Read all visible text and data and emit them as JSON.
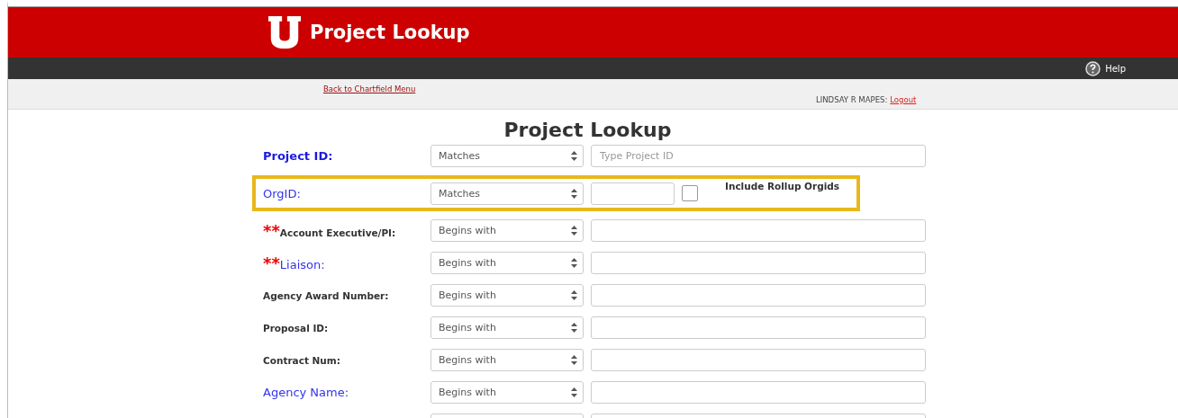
{
  "header": {
    "title": "Project Lookup"
  },
  "toolbar": {
    "help": "Help"
  },
  "subbar": {
    "back_link": "Back to Chartfield Menu",
    "user": "LINDSAY R MAPES:",
    "logout": "Logout"
  },
  "form": {
    "title": "Project Lookup",
    "rows": [
      {
        "label": "Project ID:",
        "kind": "primary",
        "operator": "Matches",
        "placeholder": "Type Project ID",
        "highlighted": false
      },
      {
        "label": "OrgID:",
        "kind": "link",
        "operator": "Matches",
        "highlighted": true,
        "checkbox": {
          "label": "Include Rollup Orgids",
          "checked": false
        }
      },
      {
        "label": "Account Executive/PI:",
        "kind": "plain",
        "required_mark": "**",
        "operator": "Begins with",
        "highlighted": false
      },
      {
        "label": "Liaison:",
        "kind": "link",
        "required_mark": "**",
        "operator": "Begins with",
        "highlighted": false
      },
      {
        "label": "Agency Award Number:",
        "kind": "plain",
        "operator": "Begins with",
        "highlighted": false
      },
      {
        "label": "Proposal ID:",
        "kind": "plain",
        "operator": "Begins with",
        "highlighted": false
      },
      {
        "label": "Contract Num:",
        "kind": "plain",
        "operator": "Begins with",
        "highlighted": false
      },
      {
        "label": "Agency Name:",
        "kind": "link",
        "operator": "Begins with",
        "highlighted": false
      },
      {
        "highlighted": false
      }
    ]
  }
}
